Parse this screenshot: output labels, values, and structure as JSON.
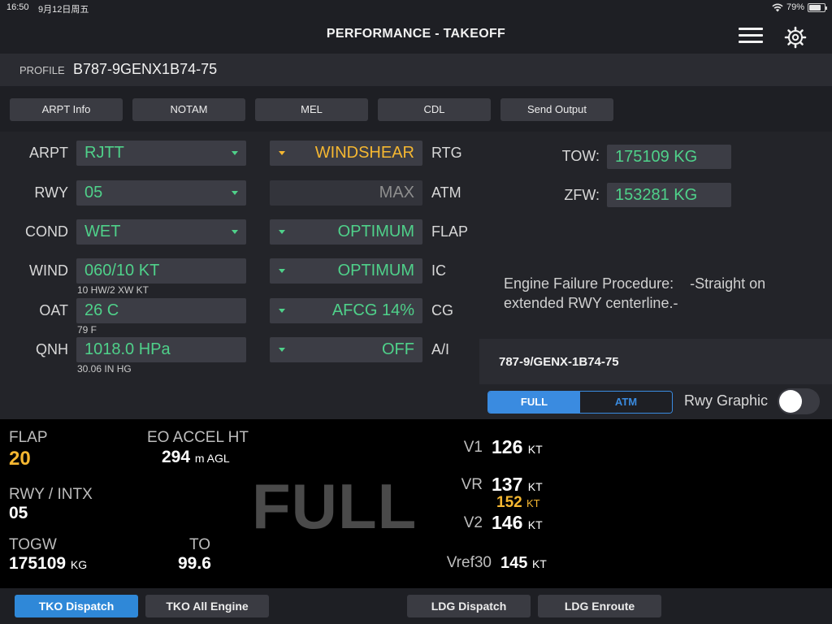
{
  "status_bar": {
    "time": "16:50",
    "date": "9月12日周五",
    "battery": "79%",
    "battery_level": 0.79
  },
  "header": {
    "title": "PERFORMANCE - TAKEOFF"
  },
  "profile": {
    "label": "PROFILE",
    "value": "B787-9GENX1B74-75"
  },
  "tools": [
    "ARPT Info",
    "NOTAM",
    "MEL",
    "CDL",
    "Send Output"
  ],
  "fields": {
    "arpt": {
      "label": "ARPT",
      "value": "RJTT"
    },
    "rwy": {
      "label": "RWY",
      "value": "05"
    },
    "cond": {
      "label": "COND",
      "value": "WET"
    },
    "wind": {
      "label": "WIND",
      "value": "060/10 KT",
      "sub": "10 HW/2 XW KT"
    },
    "oat": {
      "label": "OAT",
      "value": "26 C",
      "sub": "79 F"
    },
    "qnh": {
      "label": "QNH",
      "value": "1018.0 HPa",
      "sub": "30.06 IN HG"
    }
  },
  "options": {
    "rtg": {
      "label": "RTG",
      "value": "WINDSHEAR",
      "color": "#f5b731"
    },
    "atm": {
      "label": "ATM",
      "value": "MAX",
      "color": "#8e8e8e"
    },
    "flap": {
      "label": "FLAP",
      "value": "OPTIMUM",
      "color": "#4fd18a"
    },
    "ic": {
      "label": "IC",
      "value": "OPTIMUM",
      "color": "#4fd18a"
    },
    "cg": {
      "label": "CG",
      "value": "AFCG 14%",
      "color": "#4fd18a"
    },
    "ai": {
      "label": "A/I",
      "value": "OFF",
      "color": "#4fd18a"
    }
  },
  "weights": {
    "tow": {
      "label": "TOW:",
      "value": "175109 KG"
    },
    "zfw": {
      "label": "ZFW:",
      "value": "153281 KG"
    }
  },
  "engine_failure": {
    "label": "Engine Failure Procedure:",
    "text": "-Straight on extended RWY centerline.-"
  },
  "aircraft": "787-9/GENX-1B74-75",
  "mode_toggle": {
    "full": "FULL",
    "atm": "ATM",
    "selected": "FULL"
  },
  "rwy_graphic": {
    "label": "Rwy Graphic",
    "on": false
  },
  "results": {
    "flap_label": "FLAP",
    "flap_value": "20",
    "eo_label": "EO ACCEL HT",
    "eo_value": "294",
    "eo_unit": "m AGL",
    "rwy_intx_label": "RWY / INTX",
    "rwy_intx_value": "05",
    "togw_label": "TOGW",
    "togw_value": "175109",
    "togw_unit": "KG",
    "to_label": "TO",
    "to_value": "99.6",
    "mode_big": "FULL",
    "v1_label": "V1",
    "v1_value": "126",
    "v1_unit": "KT",
    "vr_label": "VR",
    "vr_value": "137",
    "vr_unit": "KT",
    "vr_alt_value": "152",
    "vr_alt_unit": "KT",
    "v2_label": "V2",
    "v2_value": "146",
    "v2_unit": "KT",
    "vref_label": "Vref30",
    "vref_value": "145",
    "vref_unit": "KT"
  },
  "bottom_tabs": [
    "TKO Dispatch",
    "TKO All Engine",
    "LDG Dispatch",
    "LDG Enroute"
  ],
  "colors": {
    "accent": "#2f88d8",
    "value_green": "#4fd18a",
    "warning_yellow": "#f5b731"
  }
}
